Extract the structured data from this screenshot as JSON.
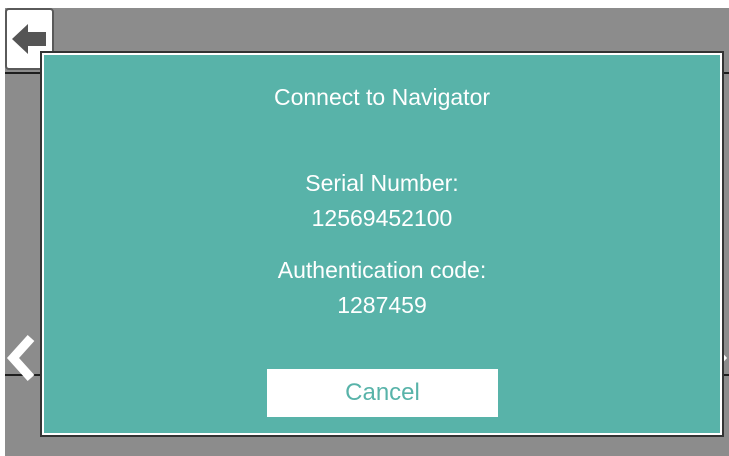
{
  "colors": {
    "dialog_background": "#58b3a9",
    "screen_background": "#8c8c8c",
    "button_background": "#ffffff",
    "button_text": "#58b3a9",
    "text": "#ffffff"
  },
  "background": {
    "back_button_icon": "arrow-left-icon",
    "prev_icon": "chevron-left-icon",
    "next_icon": "chevron-right-icon"
  },
  "dialog": {
    "title": "Connect to Navigator",
    "serial_label": "Serial Number:",
    "serial_value": "12569452100",
    "auth_label": "Authentication code:",
    "auth_value": "1287459",
    "cancel_label": "Cancel"
  }
}
